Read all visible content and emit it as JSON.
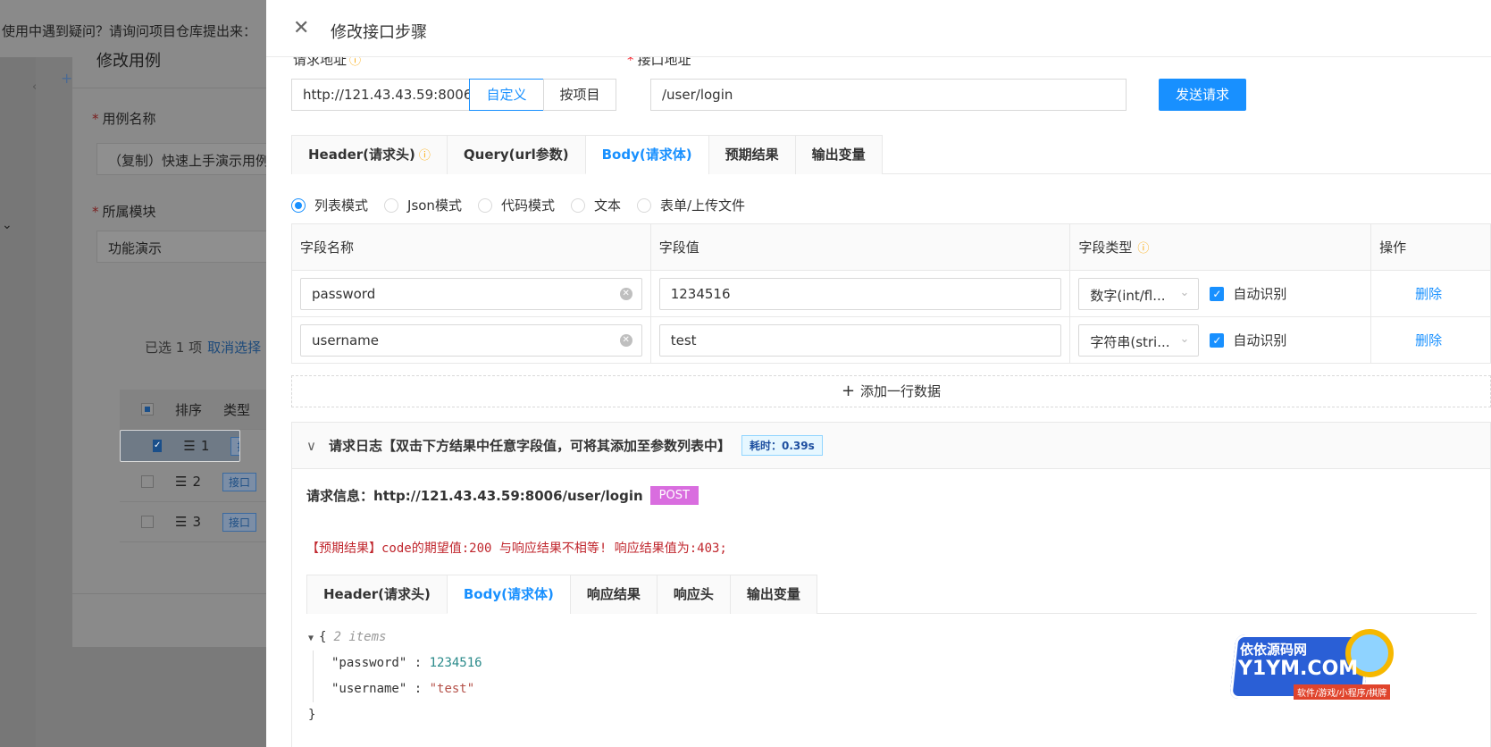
{
  "background": {
    "notice": "使用中遇到疑问？请询问项目仓库提出来：",
    "modal_title": "修改用例",
    "case_name_label": "用例名称",
    "case_name_value": "（复制）快速上手演示用例",
    "module_label": "所属模块",
    "module_value": "功能演示",
    "selected_text": "已选 1 项",
    "cancel_select": "取消选择",
    "table_headers": [
      "排序",
      "类型"
    ],
    "rows": [
      {
        "order": "1",
        "type": "接口",
        "checked": true
      },
      {
        "order": "2",
        "type": "接口",
        "checked": false
      },
      {
        "order": "3",
        "type": "接口",
        "checked": false
      }
    ]
  },
  "drawer": {
    "title": "修改接口步骤",
    "close_icon": "close-icon",
    "request_address_label": "请求地址",
    "api_address_label": "接口地址",
    "base_url": "http://121.43.43.59:8006",
    "btn_custom": "自定义",
    "btn_project": "按项目",
    "api_path": "/user/login",
    "btn_send": "发送请求",
    "tabs": [
      "Header(请求头)",
      "Query(url参数)",
      "Body(请求体)",
      "预期结果",
      "输出变量"
    ],
    "active_tab": "Body(请求体)",
    "modes": [
      "列表模式",
      "Json模式",
      "代码模式",
      "文本",
      "表单/上传文件"
    ],
    "active_mode": "列表模式",
    "table": {
      "headers": [
        "字段名称",
        "字段值",
        "字段类型",
        "操作"
      ],
      "rows": [
        {
          "name": "password",
          "value": "1234516",
          "type": "数字(int/fl...",
          "auto": "自动识别",
          "action": "删除"
        },
        {
          "name": "username",
          "value": "test",
          "type": "字符串(stri...",
          "auto": "自动识别",
          "action": "删除"
        }
      ]
    },
    "add_row": "添加一行数据",
    "log": {
      "title": "请求日志【双击下方结果中任意字段值，可将其添加至参数列表中】",
      "time": "耗时：0.39s",
      "request_info_label": "请求信息：",
      "request_url": "http://121.43.43.59:8006/user/login",
      "method": "POST",
      "expect_message": "【预期结果】code的期望值:200 与响应结果不相等! 响应结果值为:403;",
      "tabs": [
        "Header(请求头)",
        "Body(请求体)",
        "响应结果",
        "响应头",
        "输出变量"
      ],
      "active_tab": "Body(请求体)",
      "json": {
        "open": "{",
        "count": "2 items",
        "items": [
          {
            "key": "\"password\"",
            "value": "1234516",
            "kind": "number"
          },
          {
            "key": "\"username\"",
            "value": "\"test\"",
            "kind": "string"
          }
        ],
        "close": "}"
      }
    }
  },
  "watermark": {
    "line1": "依依源码网",
    "line2": "Y1YM.COM",
    "line3": "软件/游戏/小程序/棋牌"
  },
  "colors": {
    "primary": "#1890ff",
    "danger": "#c0262d",
    "post_tag": "#d96ddf",
    "info": "#faad14"
  }
}
